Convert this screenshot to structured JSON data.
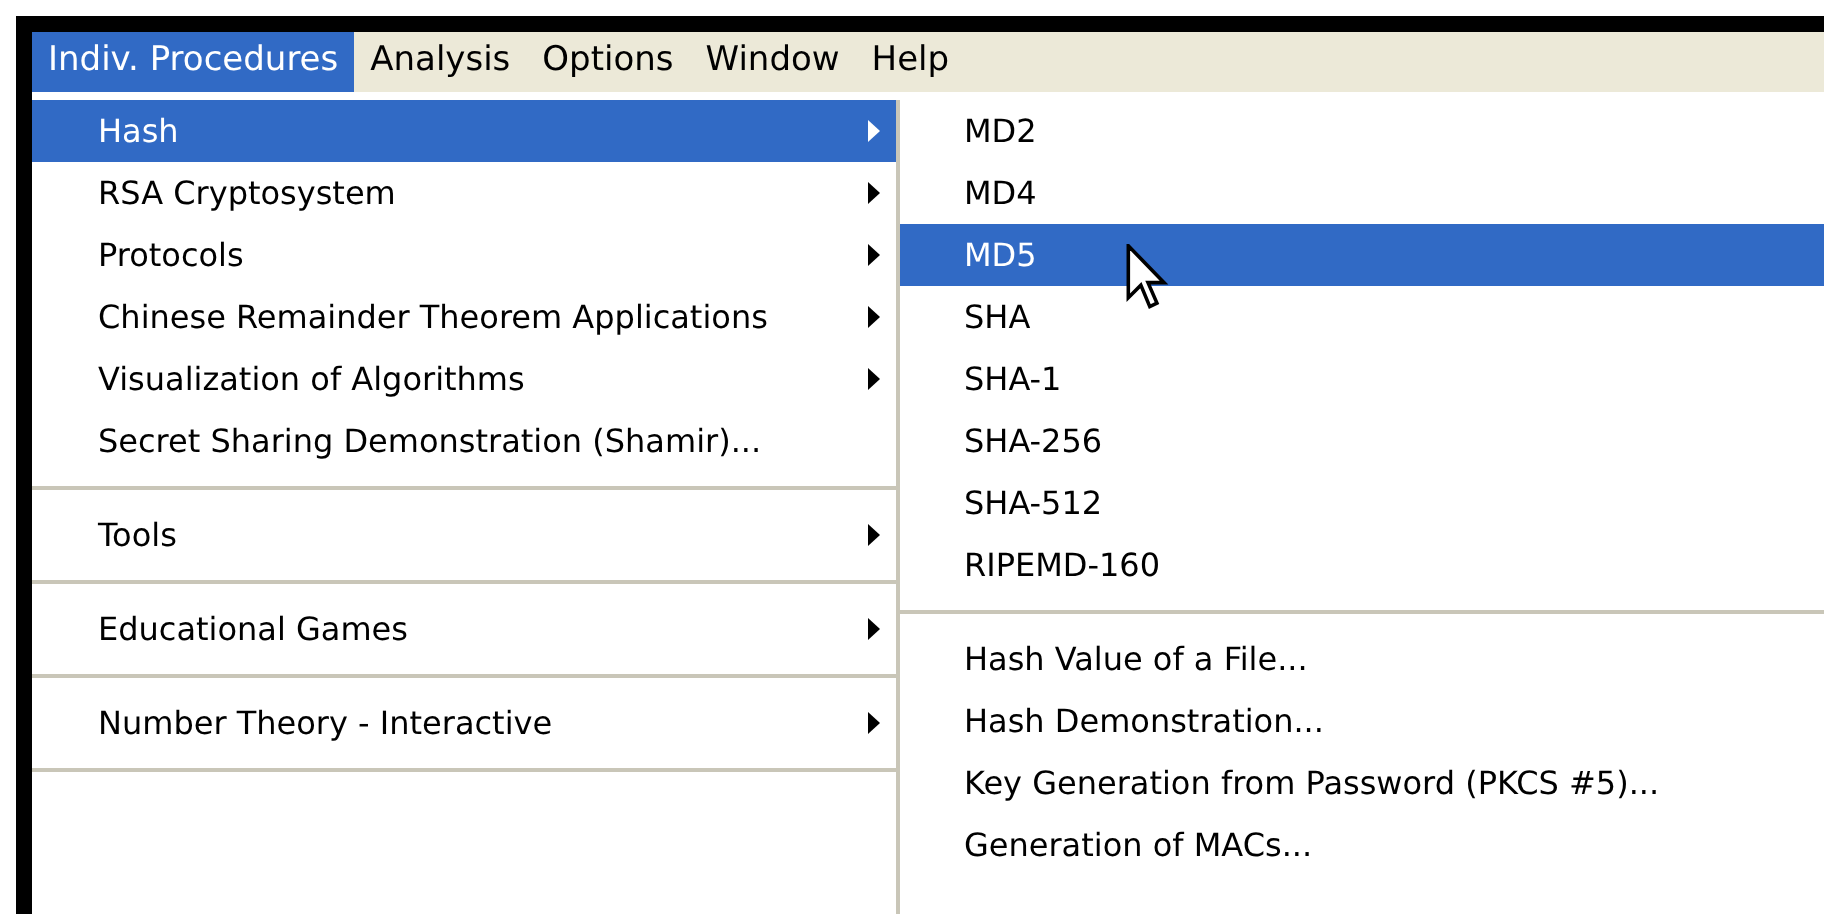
{
  "menu_bar": [
    {
      "label": "Indiv. Procedures",
      "selected": true
    },
    {
      "label": "Analysis",
      "selected": false
    },
    {
      "label": "Options",
      "selected": false
    },
    {
      "label": "Window",
      "selected": false
    },
    {
      "label": "Help",
      "selected": false
    }
  ],
  "menu": {
    "items": [
      {
        "kind": "item",
        "label": "Hash",
        "selected": true,
        "submenu": true
      },
      {
        "kind": "item",
        "label": "RSA Cryptosystem",
        "selected": false,
        "submenu": true
      },
      {
        "kind": "item",
        "label": "Protocols",
        "selected": false,
        "submenu": true
      },
      {
        "kind": "item",
        "label": "Chinese Remainder Theorem Applications",
        "selected": false,
        "submenu": true
      },
      {
        "kind": "item",
        "label": "Visualization of Algorithms",
        "selected": false,
        "submenu": true
      },
      {
        "kind": "item",
        "label": "Secret Sharing Demonstration (Shamir)...",
        "selected": false,
        "submenu": false
      },
      {
        "kind": "separator"
      },
      {
        "kind": "item",
        "label": "Tools",
        "selected": false,
        "submenu": true
      },
      {
        "kind": "separator"
      },
      {
        "kind": "item",
        "label": "Educational Games",
        "selected": false,
        "submenu": true
      },
      {
        "kind": "separator"
      },
      {
        "kind": "item",
        "label": "Number Theory - Interactive",
        "selected": false,
        "submenu": true
      },
      {
        "kind": "separator"
      }
    ]
  },
  "submenu": {
    "items": [
      {
        "kind": "item",
        "label": "MD2",
        "selected": false,
        "submenu": false
      },
      {
        "kind": "item",
        "label": "MD4",
        "selected": false,
        "submenu": false
      },
      {
        "kind": "item",
        "label": "MD5",
        "selected": true,
        "submenu": false
      },
      {
        "kind": "item",
        "label": "SHA",
        "selected": false,
        "submenu": false
      },
      {
        "kind": "item",
        "label": "SHA-1",
        "selected": false,
        "submenu": false
      },
      {
        "kind": "item",
        "label": "SHA-256",
        "selected": false,
        "submenu": false
      },
      {
        "kind": "item",
        "label": "SHA-512",
        "selected": false,
        "submenu": false
      },
      {
        "kind": "item",
        "label": "RIPEMD-160",
        "selected": false,
        "submenu": false
      },
      {
        "kind": "separator"
      },
      {
        "kind": "item",
        "label": "Hash Value of a File...",
        "selected": false,
        "submenu": false
      },
      {
        "kind": "item",
        "label": "Hash Demonstration...",
        "selected": false,
        "submenu": false
      },
      {
        "kind": "item",
        "label": "Key Generation from Password (PKCS #5)...",
        "selected": false,
        "submenu": false
      },
      {
        "kind": "item",
        "label": "Generation of MACs...",
        "selected": false,
        "submenu": false
      }
    ]
  }
}
